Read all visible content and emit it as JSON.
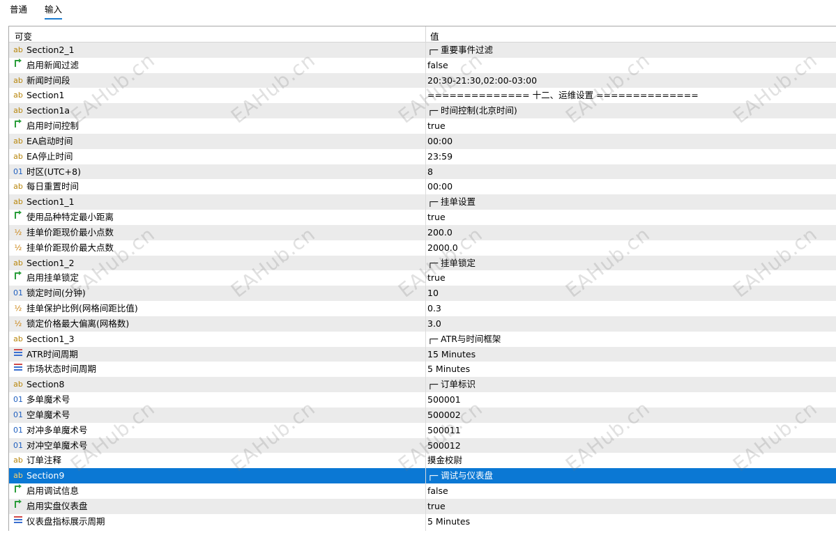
{
  "tabs": [
    "普通",
    "输入"
  ],
  "columns": {
    "name": "可变",
    "value": "值"
  },
  "watermark": "EAHub.cn",
  "rows": [
    {
      "icon": "ab",
      "name": "Section2_1",
      "value": "┌─ 重要事件过滤"
    },
    {
      "icon": "bool",
      "name": "启用新闻过滤",
      "value": "false"
    },
    {
      "icon": "ab",
      "name": "新闻时间段",
      "value": "20:30-21:30,02:00-03:00"
    },
    {
      "icon": "ab",
      "name": "Section1",
      "value": "============== 十二、运维设置 =============="
    },
    {
      "icon": "ab",
      "name": "Section1a",
      "value": "┌─ 时间控制(北京时间)"
    },
    {
      "icon": "bool",
      "name": "启用时间控制",
      "value": "true"
    },
    {
      "icon": "ab",
      "name": "EA启动时间",
      "value": "00:00"
    },
    {
      "icon": "ab",
      "name": "EA停止时间",
      "value": "23:59"
    },
    {
      "icon": "01",
      "name": "时区(UTC+8)",
      "value": "8"
    },
    {
      "icon": "ab",
      "name": "每日重置时间",
      "value": "00:00"
    },
    {
      "icon": "ab",
      "name": "Section1_1",
      "value": "┌─ 挂单设置"
    },
    {
      "icon": "bool",
      "name": "使用品种特定最小距离",
      "value": "true"
    },
    {
      "icon": "half",
      "name": "挂单价距现价最小点数",
      "value": "200.0"
    },
    {
      "icon": "half",
      "name": "挂单价距现价最大点数",
      "value": "2000.0"
    },
    {
      "icon": "ab",
      "name": "Section1_2",
      "value": "┌─ 挂单锁定"
    },
    {
      "icon": "bool",
      "name": "启用挂单锁定",
      "value": "true"
    },
    {
      "icon": "01",
      "name": "锁定时间(分钟)",
      "value": "10"
    },
    {
      "icon": "half",
      "name": "挂单保护比例(网格间距比值)",
      "value": "0.3"
    },
    {
      "icon": "half",
      "name": "锁定价格最大偏离(网格数)",
      "value": "3.0"
    },
    {
      "icon": "ab",
      "name": "Section1_3",
      "value": "┌─ ATR与时间框架"
    },
    {
      "icon": "enum",
      "name": "ATR时间周期",
      "value": "15 Minutes"
    },
    {
      "icon": "enum",
      "name": "市场状态时间周期",
      "value": "5 Minutes"
    },
    {
      "icon": "ab",
      "name": "Section8",
      "value": "┌─ 订单标识"
    },
    {
      "icon": "01",
      "name": "多单魔术号",
      "value": "500001"
    },
    {
      "icon": "01",
      "name": "空单魔术号",
      "value": "500002"
    },
    {
      "icon": "01",
      "name": "对冲多单魔术号",
      "value": "500011"
    },
    {
      "icon": "01",
      "name": "对冲空单魔术号",
      "value": "500012"
    },
    {
      "icon": "ab",
      "name": "订单注释",
      "value": "摸金校尉"
    },
    {
      "icon": "ab",
      "name": "Section9",
      "value": "┌─ 调试与仪表盘",
      "selected": true
    },
    {
      "icon": "bool",
      "name": "启用调试信息",
      "value": "false"
    },
    {
      "icon": "bool",
      "name": "启用实盘仪表盘",
      "value": "true"
    },
    {
      "icon": "enum",
      "name": "仪表盘指标展示周期",
      "value": "5 Minutes"
    }
  ]
}
